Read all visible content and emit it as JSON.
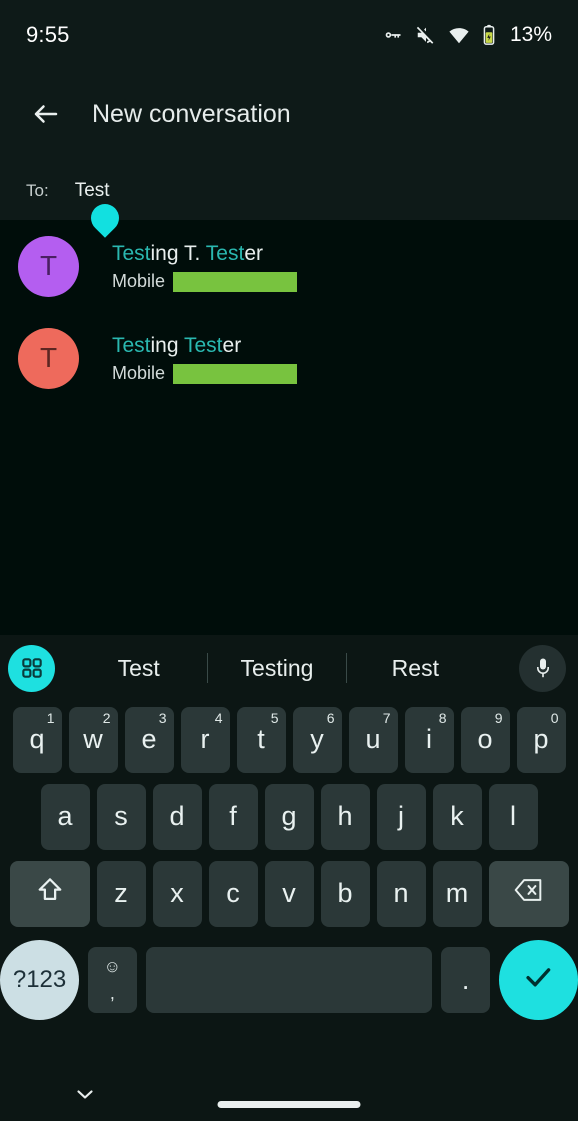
{
  "status_bar": {
    "time": "9:55",
    "battery_percent": "13%",
    "icons": [
      "vpn-key-icon",
      "volume-muted-icon",
      "wifi-icon",
      "battery-icon"
    ]
  },
  "header": {
    "back_icon": "back-arrow-icon",
    "title": "New conversation",
    "recipient_label": "To:",
    "recipient_value": "Test"
  },
  "contacts": [
    {
      "initial": "T",
      "avatar_color": "#b45ef0",
      "avatar_text_color": "#4a1f63",
      "name_parts": [
        {
          "text": "Test",
          "highlight": true
        },
        {
          "text": "ing T. ",
          "highlight": false
        },
        {
          "text": "Test",
          "highlight": true
        },
        {
          "text": "er",
          "highlight": false
        }
      ],
      "phone_type": "Mobile",
      "phone_number": ""
    },
    {
      "initial": "T",
      "avatar_color": "#ee6a5c",
      "avatar_text_color": "#5c2622",
      "name_parts": [
        {
          "text": "Test",
          "highlight": true
        },
        {
          "text": "ing ",
          "highlight": false
        },
        {
          "text": "Test",
          "highlight": true
        },
        {
          "text": "er",
          "highlight": false
        }
      ],
      "phone_type": "Mobile",
      "phone_number": ""
    }
  ],
  "keyboard": {
    "suggestion_launcher_icon": "grid-apps-icon",
    "suggestions": [
      "Test",
      "Testing",
      "Rest"
    ],
    "mic_icon": "microphone-icon",
    "row1": [
      {
        "letter": "q",
        "num": "1"
      },
      {
        "letter": "w",
        "num": "2"
      },
      {
        "letter": "e",
        "num": "3"
      },
      {
        "letter": "r",
        "num": "4"
      },
      {
        "letter": "t",
        "num": "5"
      },
      {
        "letter": "y",
        "num": "6"
      },
      {
        "letter": "u",
        "num": "7"
      },
      {
        "letter": "i",
        "num": "8"
      },
      {
        "letter": "o",
        "num": "9"
      },
      {
        "letter": "p",
        "num": "0"
      }
    ],
    "row2": [
      "a",
      "s",
      "d",
      "f",
      "g",
      "h",
      "j",
      "k",
      "l"
    ],
    "row3": [
      "z",
      "x",
      "c",
      "v",
      "b",
      "n",
      "m"
    ],
    "shift_icon": "shift-arrow-icon",
    "backspace_icon": "backspace-icon",
    "symbols_label": "?123",
    "emoji_icon": "emoji-smiley-icon",
    "comma_label": ",",
    "space_label": "",
    "period_label": ".",
    "enter_icon": "checkmark-icon"
  },
  "nav_bar": {
    "hide_keyboard_icon": "chevron-down-icon",
    "home_indicator": "home-indicator-pill"
  },
  "colors": {
    "background": "#000d0a",
    "surface": "#0e1a18",
    "accent_cyan": "#1ee0e0",
    "highlight_teal": "#2ab8b0",
    "redaction_green": "#78c33f",
    "key_bg": "#2b3838"
  }
}
